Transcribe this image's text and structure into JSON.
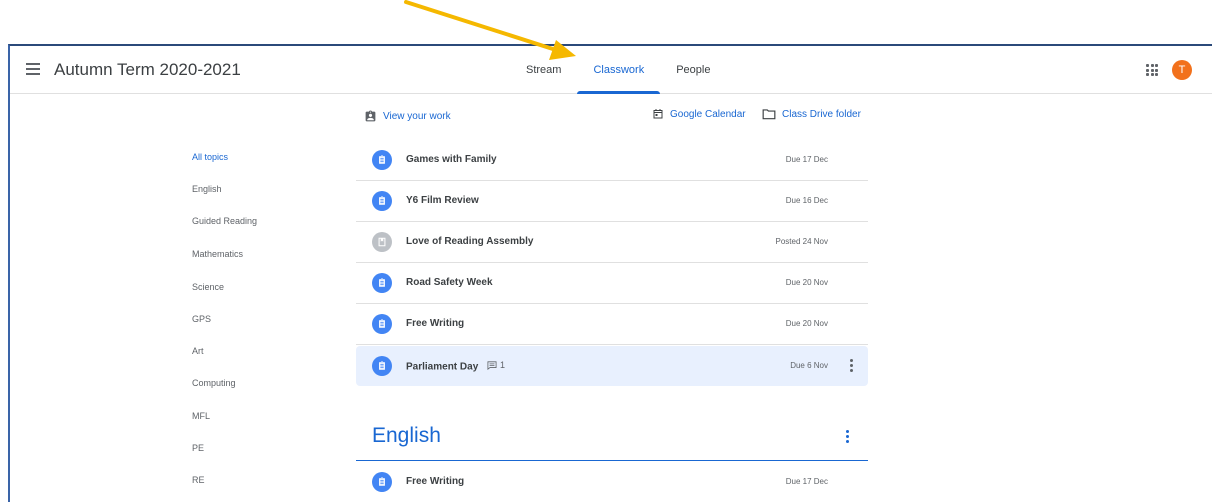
{
  "header": {
    "class_title": "Autumn Term 2020-2021",
    "tabs": [
      {
        "label": "Stream"
      },
      {
        "label": "Classwork"
      },
      {
        "label": "People"
      }
    ],
    "avatar_letter": "T",
    "avatar_color": "#f2711c"
  },
  "toolbar": {
    "view_work": "View your work",
    "calendar": "Google Calendar",
    "drive": "Class Drive folder"
  },
  "topics": [
    "All topics",
    "English",
    "Guided Reading",
    "Mathematics",
    "Science",
    "GPS",
    "Art",
    "Computing",
    "MFL",
    "PE",
    "RE"
  ],
  "classwork": [
    {
      "title": "Games with Family",
      "due": "Due 17 Dec",
      "icon": "assignment-icon"
    },
    {
      "title": "Y6 Film Review",
      "due": "Due 16 Dec",
      "icon": "assignment-icon"
    },
    {
      "title": "Love of Reading Assembly",
      "due": "Posted 24 Nov",
      "icon": "material-icon"
    },
    {
      "title": "Road Safety Week",
      "due": "Due 20 Nov",
      "icon": "assignment-icon"
    },
    {
      "title": "Free Writing",
      "due": "Due 20 Nov",
      "icon": "assignment-icon"
    },
    {
      "title": "Parliament Day",
      "comments": "1",
      "due": "Due 6 Nov",
      "icon": "assignment-icon"
    }
  ],
  "section": {
    "title": "English",
    "items": [
      {
        "title": "Free Writing",
        "due": "Due 17 Dec",
        "icon": "assignment-icon"
      }
    ]
  },
  "colors": {
    "accent": "#1967d2",
    "assignment_icon": "#4285f4",
    "material_icon": "#bdc1c6",
    "highlight_row": "#e8f0fe",
    "annotation_arrow": "#f5b800"
  }
}
